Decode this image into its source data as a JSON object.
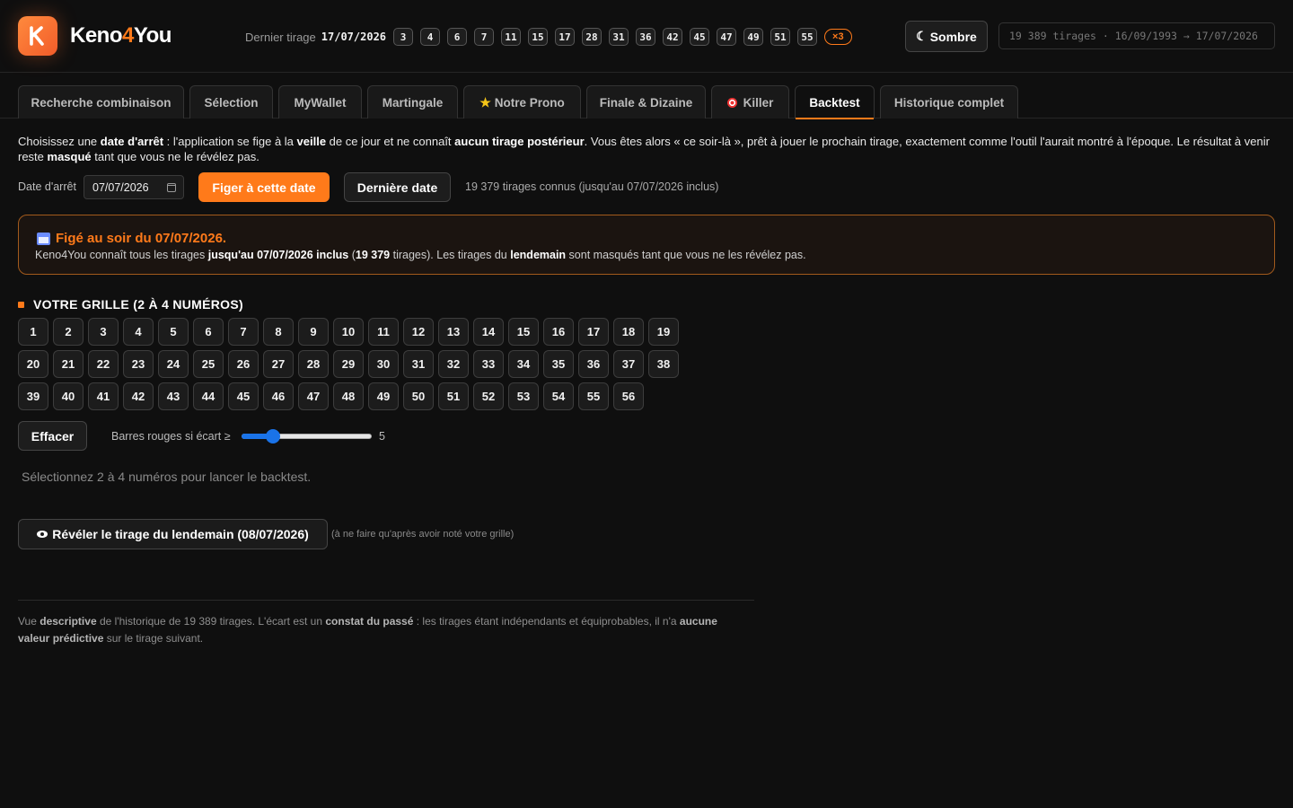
{
  "header": {
    "brand_part1": "Keno",
    "brand_part2": "4",
    "brand_part3": "You",
    "last_draw_label": "Dernier tirage",
    "last_draw_date": "17/07/2026",
    "last_draw_numbers": [
      "3",
      "4",
      "6",
      "7",
      "11",
      "15",
      "17",
      "28",
      "31",
      "36",
      "42",
      "45",
      "47",
      "49",
      "51",
      "55"
    ],
    "multiplier": "×3",
    "theme_label": "Sombre",
    "db_info": "19 389 tirages · 16/09/1993 → 17/07/2026"
  },
  "tabs": [
    {
      "label": "Recherche combinaison",
      "icon": ""
    },
    {
      "label": "Sélection",
      "icon": ""
    },
    {
      "label": "MyWallet",
      "icon": ""
    },
    {
      "label": "Martingale",
      "icon": ""
    },
    {
      "label": "Notre Prono",
      "icon": "star-icon"
    },
    {
      "label": "Finale & Dizaine",
      "icon": ""
    },
    {
      "label": "Killer",
      "icon": "target-icon"
    },
    {
      "label": "Backtest",
      "icon": ""
    },
    {
      "label": "Historique complet",
      "icon": ""
    }
  ],
  "active_tab": "Backtest",
  "intro": {
    "t1": "Choisissez une ",
    "b1": "date d'arrêt",
    "t2": " : l'application se fige à la ",
    "b2": "veille",
    "t3": " de ce jour et ne connaît ",
    "b3": "aucun tirage postérieur",
    "t4": ". Vous êtes alors « ce soir-là », prêt à jouer le prochain tirage, exactement comme l'outil l'aurait montré à l'époque. Le résultat à venir reste ",
    "b4": "masqué",
    "t5": " tant que vous ne le révélez pas."
  },
  "stop": {
    "label": "Date d'arrêt",
    "value": "07/07/2026",
    "freeze_button": "Figer à cette date",
    "last_date_button": "Dernière date",
    "known_text": "19 379 tirages connus (jusqu'au 07/07/2026 inclus)"
  },
  "frozen": {
    "title": "Figé au soir du 07/07/2026.",
    "t1": "Keno4You connaît tous les tirages ",
    "b1": "jusqu'au 07/07/2026 inclus",
    "t2": " (",
    "b2": "19 379",
    "t3": " tirages). Les tirages du ",
    "b3": "lendemain",
    "t4": " sont masqués tant que vous ne les révélez pas."
  },
  "grid": {
    "title": "VOTRE GRILLE (2 À 4 NUMÉROS)",
    "numbers": [
      "1",
      "2",
      "3",
      "4",
      "5",
      "6",
      "7",
      "8",
      "9",
      "10",
      "11",
      "12",
      "13",
      "14",
      "15",
      "16",
      "17",
      "18",
      "19",
      "20",
      "21",
      "22",
      "23",
      "24",
      "25",
      "26",
      "27",
      "28",
      "29",
      "30",
      "31",
      "32",
      "33",
      "34",
      "35",
      "36",
      "37",
      "38",
      "39",
      "40",
      "41",
      "42",
      "43",
      "44",
      "45",
      "46",
      "47",
      "48",
      "49",
      "50",
      "51",
      "52",
      "53",
      "54",
      "55",
      "56"
    ],
    "clear_button": "Effacer",
    "slider_label": "Barres rouges si écart ≥",
    "slider_value": "5",
    "slider_min": 1,
    "slider_max": 20,
    "hint": "Sélectionnez 2 à 4 numéros pour lancer le backtest."
  },
  "reveal": {
    "button": "Révéler le tirage du lendemain (08/07/2026)",
    "note": "(à ne faire qu'après avoir noté votre grille)"
  },
  "footer": {
    "t1": "Vue ",
    "b1": "descriptive",
    "t2": " de l'historique de 19 389 tirages. L'écart est un ",
    "b2": "constat du passé",
    "t3": " : les tirages étant indépendants et équiprobables, il n'a ",
    "b3": "aucune valeur prédictive",
    "t4": " sur le tirage suivant."
  },
  "colors": {
    "accent": "#ff7a1a",
    "background": "#0f0f0f",
    "slider": "#1a73e8"
  }
}
